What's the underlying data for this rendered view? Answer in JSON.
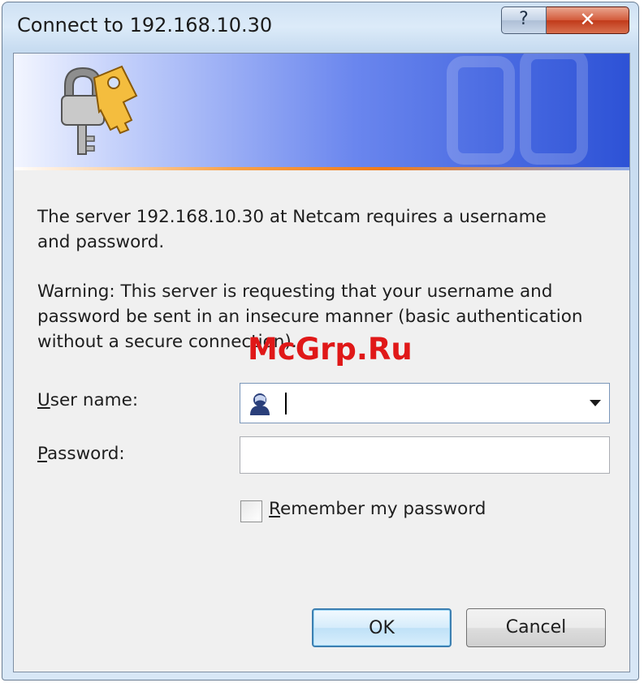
{
  "window": {
    "title": "Connect to 192.168.10.30",
    "help_label": "?",
    "close_label": "✕"
  },
  "message": {
    "line1": "The server 192.168.10.30 at Netcam requires a username\nand password.",
    "line2": "Warning: This server is requesting that your username and\npassword be sent in an insecure manner (basic authentication\nwithout a secure connection)."
  },
  "form": {
    "username_label_first": "U",
    "username_label_rest": "ser name:",
    "username_value": "",
    "password_label_first": "P",
    "password_label_rest": "assword:",
    "password_value": "",
    "remember_label_first": "R",
    "remember_label_rest": "emember my password",
    "remember_checked": false
  },
  "buttons": {
    "ok_label": "OK",
    "cancel_label": "Cancel"
  },
  "watermark": "McGrp.Ru",
  "icons": {
    "banner": "keys-icon",
    "user": "user-icon",
    "dropdown": "chevron-down-icon"
  }
}
